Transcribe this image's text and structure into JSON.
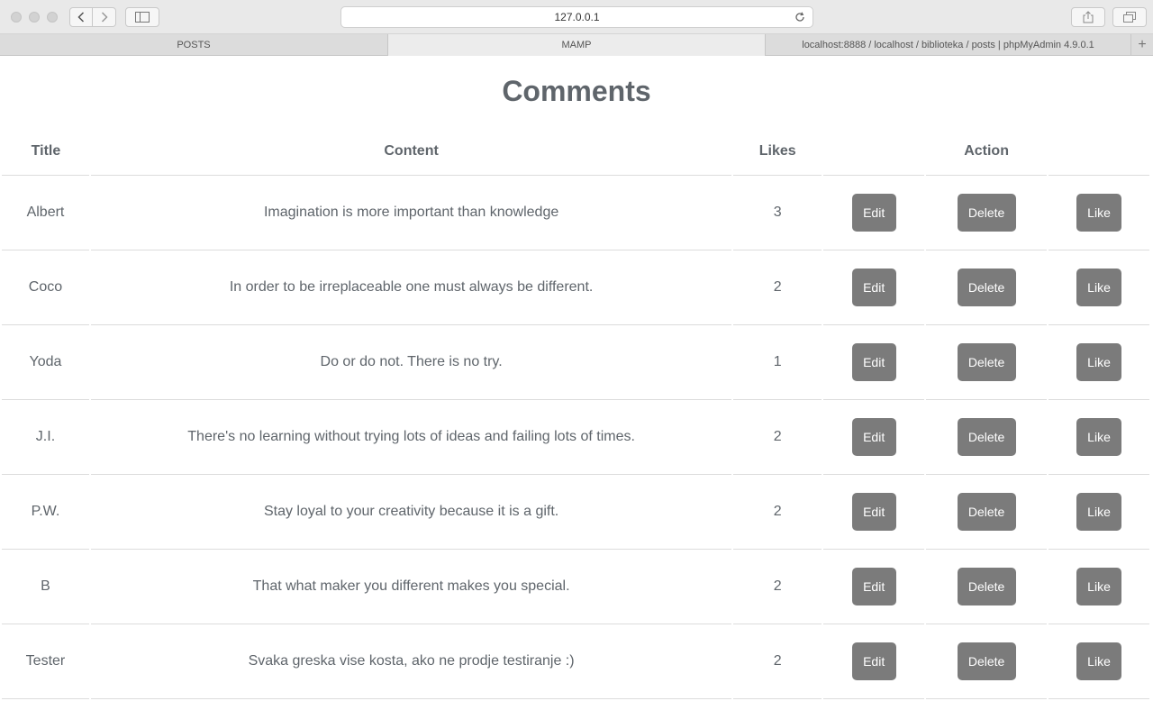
{
  "browser": {
    "url": "127.0.0.1",
    "tabs": [
      {
        "label": "POSTS",
        "active": false
      },
      {
        "label": "MAMP",
        "active": true
      },
      {
        "label": "localhost:8888 / localhost / biblioteka / posts | phpMyAdmin 4.9.0.1",
        "active": false
      }
    ],
    "new_tab": "+"
  },
  "page": {
    "title": "Comments",
    "columns": {
      "title": "Title",
      "content": "Content",
      "likes": "Likes",
      "action": "Action"
    },
    "actions": {
      "edit": "Edit",
      "delete": "Delete",
      "like": "Like"
    },
    "rows": [
      {
        "title": "Albert",
        "content": "Imagination is more important than knowledge",
        "likes": "3"
      },
      {
        "title": "Coco",
        "content": "In order to be irreplaceable one must always be different.",
        "likes": "2"
      },
      {
        "title": "Yoda",
        "content": "Do or do not. There is no try.",
        "likes": "1"
      },
      {
        "title": "J.I.",
        "content": "There's no learning without trying lots of ideas and failing lots of times.",
        "likes": "2"
      },
      {
        "title": "P.W.",
        "content": "Stay loyal to your creativity because it is a gift.",
        "likes": "2"
      },
      {
        "title": "B",
        "content": "That what maker you different makes you special.",
        "likes": "2"
      },
      {
        "title": "Tester",
        "content": "Svaka greska vise kosta, ako ne prodje testiranje :)",
        "likes": "2"
      }
    ]
  }
}
